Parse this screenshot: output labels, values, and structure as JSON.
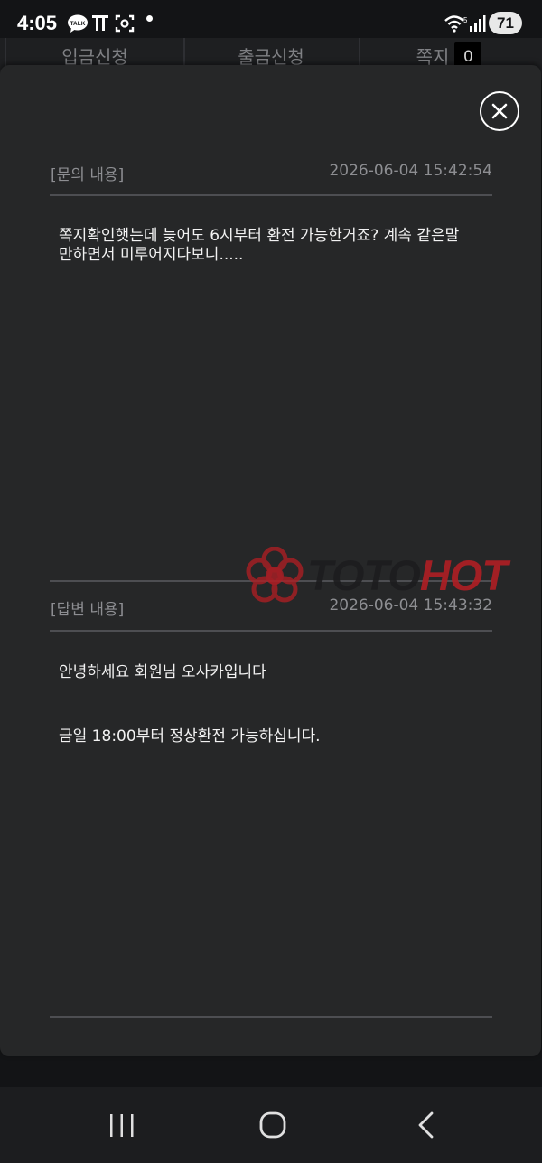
{
  "status_bar": {
    "time": "4:05",
    "battery": "71",
    "notification_icons": [
      "talk-icon",
      "t-icon",
      "scan-icon",
      "dot-icon"
    ]
  },
  "tabs": [
    {
      "label": "입금신청"
    },
    {
      "label": "출금신청"
    },
    {
      "label": "쪽지",
      "badge": "0"
    }
  ],
  "inquiry": {
    "title": "[문의 내용]",
    "date": "2026-06-04 15:42:54",
    "body": "쪽지확인햇는데  늦어도 6시부터 환전 가능한거죠?  계속 같은말\n만하면서 미루어지다보니....."
  },
  "answer": {
    "title": "[답변 내용]",
    "date": "2026-06-04 15:43:32",
    "line1": "안녕하세요 회원님 오사카입니다",
    "line2": "금일 18:00부터 정상환전 가능하십니다."
  },
  "watermark": {
    "part1": "TOTO",
    "part2": "HOT"
  },
  "colors": {
    "background": "#131416",
    "modal": "#262728",
    "watermark_red": "#b01f24"
  }
}
